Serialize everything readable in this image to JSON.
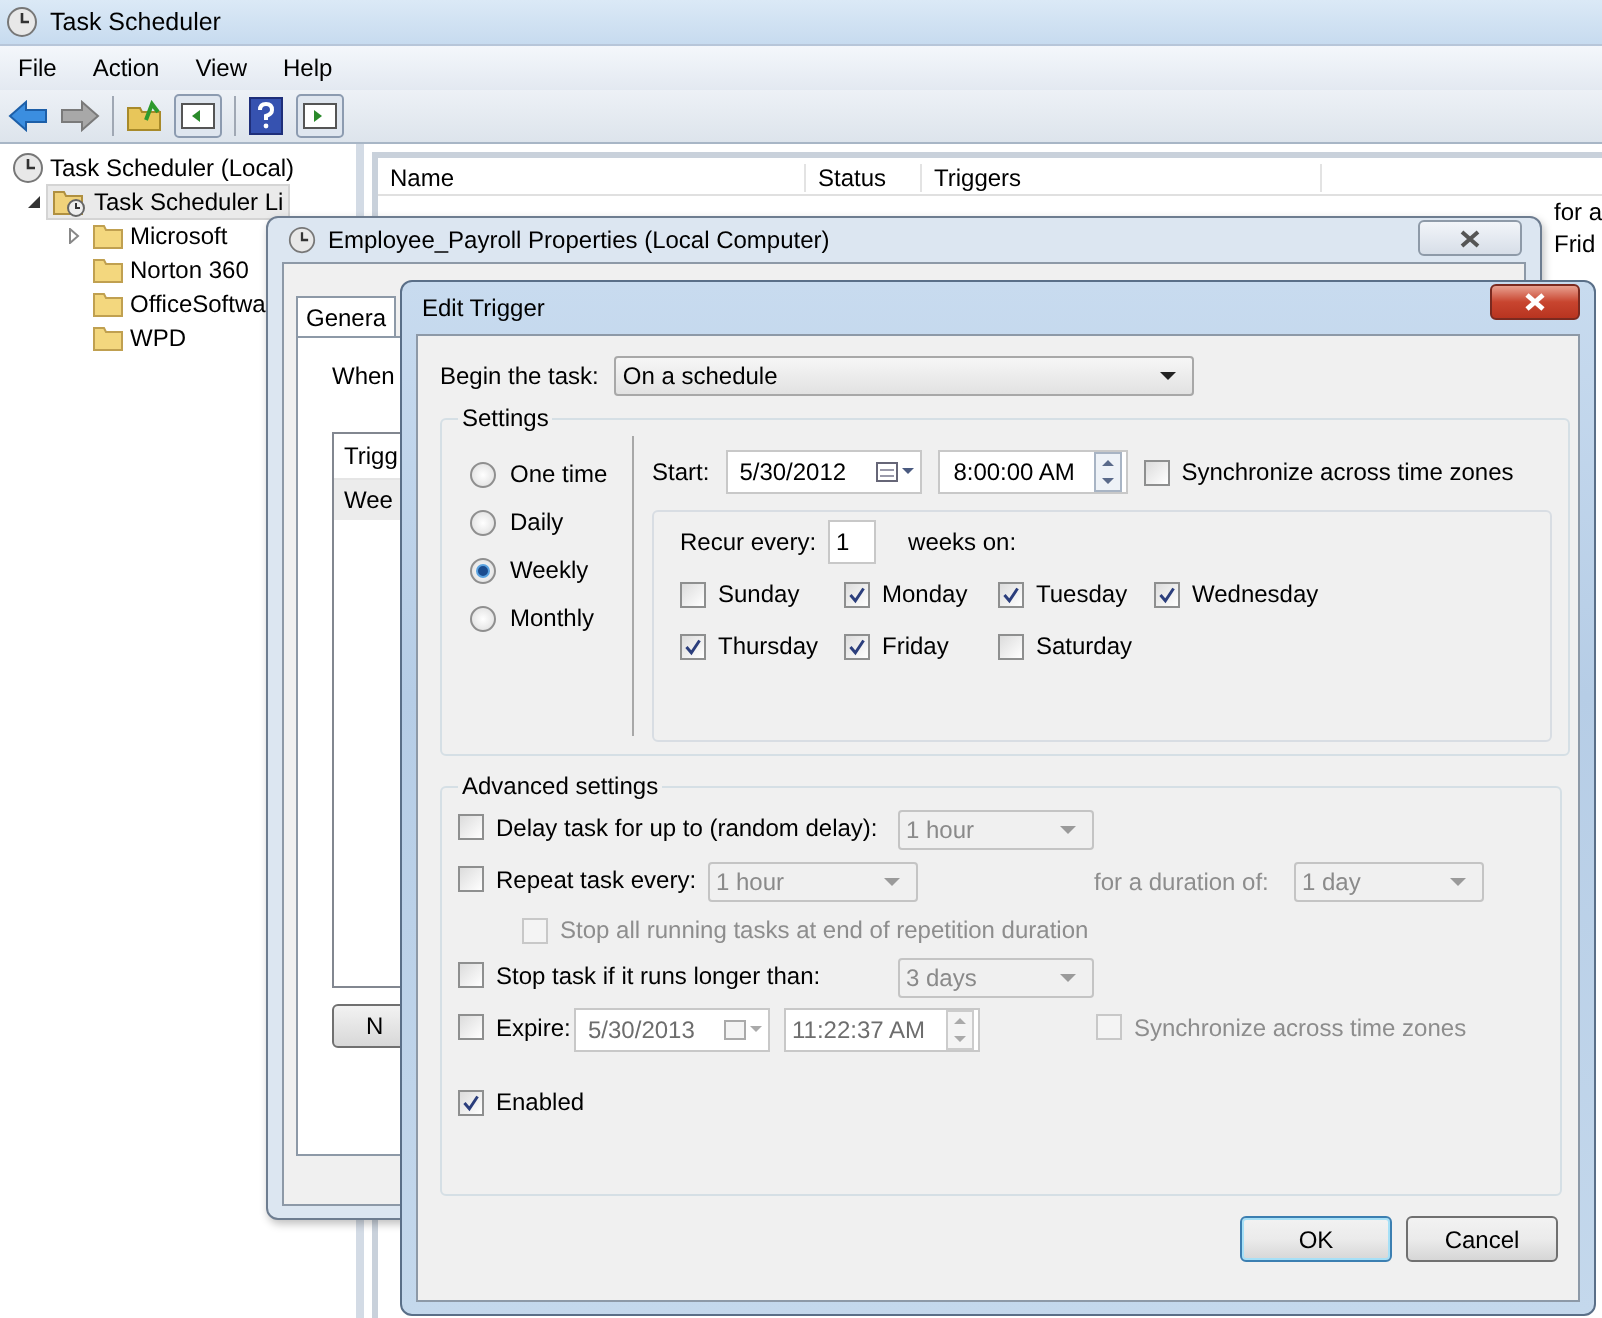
{
  "window": {
    "title": "Task Scheduler"
  },
  "menu": [
    "File",
    "Action",
    "View",
    "Help"
  ],
  "tree": [
    {
      "label": "Task Scheduler (Local)",
      "selected": false,
      "children": [
        {
          "label": "Task Scheduler Li",
          "selected": true,
          "expanded": true,
          "children": [
            {
              "label": "Microsoft",
              "selected": false,
              "expanded": false
            },
            {
              "label": "Norton 360",
              "selected": false
            },
            {
              "label": "OfficeSoftwa",
              "selected": false
            },
            {
              "label": "WPD",
              "selected": false
            }
          ]
        }
      ]
    }
  ],
  "task_list": {
    "columns": [
      "Name",
      "Status",
      "Triggers"
    ],
    "visible_cells": [
      "for a",
      "Frid"
    ]
  },
  "properties_dialog": {
    "title": "Employee_Payroll Properties (Local Computer)",
    "tabs": [
      {
        "label": "Genera",
        "selected": true
      }
    ],
    "when_label": "When",
    "triggers_table": {
      "columns": [
        "Trigg"
      ],
      "rows": [
        "Wee"
      ]
    },
    "button": "N"
  },
  "edit_trigger": {
    "title": "Edit Trigger",
    "begin_task": {
      "label": "Begin the task:",
      "value": "On a schedule"
    },
    "settings": {
      "title": "Settings",
      "schedules": [
        {
          "label": "One time",
          "selected": false
        },
        {
          "label": "Daily",
          "selected": false
        },
        {
          "label": "Weekly",
          "selected": true
        },
        {
          "label": "Monthly",
          "selected": false
        }
      ],
      "start": {
        "label": "Start:",
        "date": "5/30/2012",
        "time": "8:00:00 AM"
      },
      "sync": {
        "label": "Synchronize across time zones",
        "checked": false,
        "disabled": false
      },
      "recur": {
        "label": "Recur every:",
        "value": "1",
        "suffix": "weeks on:"
      },
      "days": [
        {
          "label": "Sunday",
          "checked": false
        },
        {
          "label": "Monday",
          "checked": true
        },
        {
          "label": "Tuesday",
          "checked": true
        },
        {
          "label": "Wednesday",
          "checked": true
        },
        {
          "label": "Thursday",
          "checked": true
        },
        {
          "label": "Friday",
          "checked": true
        },
        {
          "label": "Saturday",
          "checked": false
        }
      ]
    },
    "advanced": {
      "title": "Advanced settings",
      "delay": {
        "label": "Delay task for up to (random delay):",
        "checked": false,
        "value": "1 hour",
        "disabled": true
      },
      "repeat": {
        "label": "Repeat task every:",
        "checked": false,
        "value": "1 hour",
        "disabled": true,
        "duration_label": "for a duration of:",
        "duration": "1 day"
      },
      "stop_all": {
        "label": "Stop all running tasks at end of repetition duration",
        "checked": false,
        "disabled": true
      },
      "stop_if": {
        "label": "Stop task if it runs longer than:",
        "checked": false,
        "value": "3 days",
        "disabled": true
      },
      "expire": {
        "label": "Expire:",
        "checked": false,
        "date": "5/30/2013",
        "time": "11:22:37 AM",
        "disabled": true
      },
      "expire_sync": {
        "label": "Synchronize across time zones",
        "checked": false,
        "disabled": true
      },
      "enabled": {
        "label": "Enabled",
        "checked": true,
        "disabled": false
      }
    },
    "buttons": [
      "OK",
      "Cancel"
    ]
  }
}
